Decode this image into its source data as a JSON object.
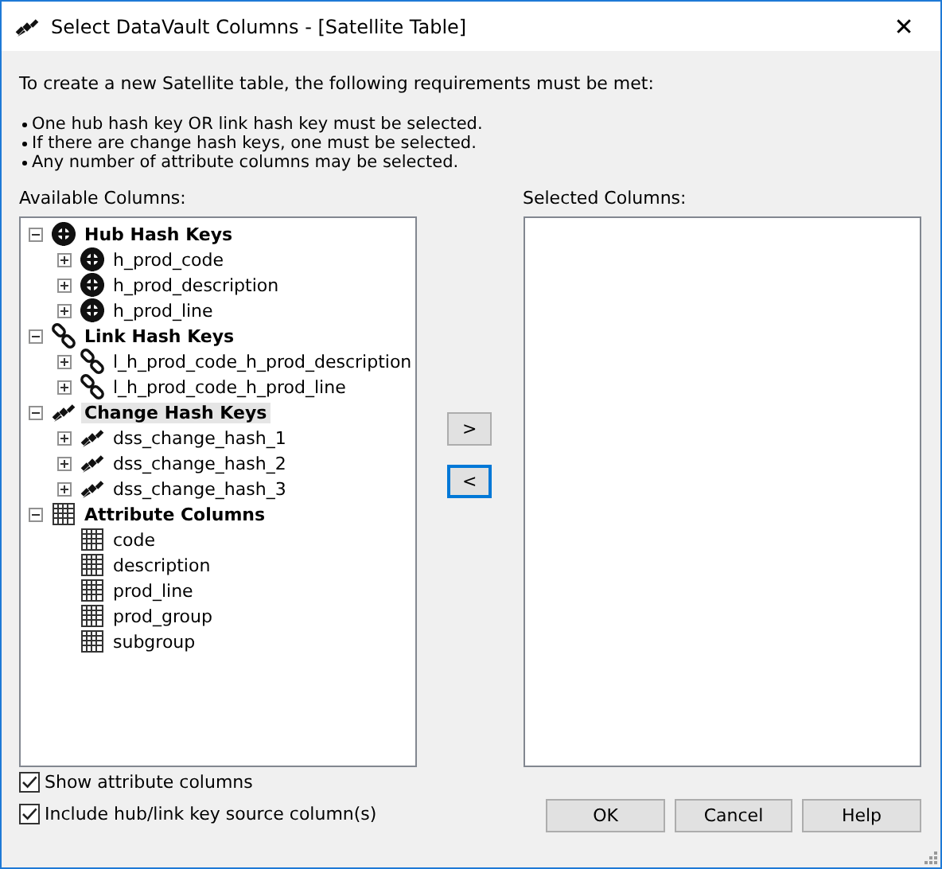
{
  "window": {
    "title": "Select DataVault Columns - [Satellite Table]",
    "close": "✕"
  },
  "intro": "To create a new Satellite table, the following requirements must be met:",
  "requirements": [
    "One hub hash key OR link hash key must be selected.",
    "If there are change hash keys, one must be selected.",
    "Any number of attribute columns may be selected."
  ],
  "available": {
    "label": "Available Columns:",
    "tree": [
      {
        "label": "Hub Hash Keys",
        "kind": "hub",
        "expanded": true,
        "selected": false,
        "children": [
          {
            "label": "h_prod_code",
            "expandable": true,
            "selected": false
          },
          {
            "label": "h_prod_description",
            "expandable": true,
            "selected": false
          },
          {
            "label": "h_prod_line",
            "expandable": true,
            "selected": false
          }
        ]
      },
      {
        "label": "Link Hash Keys",
        "kind": "link",
        "expanded": true,
        "selected": false,
        "children": [
          {
            "label": "l_h_prod_code_h_prod_description",
            "expandable": true,
            "selected": false
          },
          {
            "label": "l_h_prod_code_h_prod_line",
            "expandable": true,
            "selected": false
          }
        ]
      },
      {
        "label": "Change Hash Keys",
        "kind": "change",
        "expanded": true,
        "selected": true,
        "children": [
          {
            "label": "dss_change_hash_1",
            "expandable": true,
            "selected": false
          },
          {
            "label": "dss_change_hash_2",
            "expandable": true,
            "selected": false
          },
          {
            "label": "dss_change_hash_3",
            "expandable": true,
            "selected": false
          }
        ]
      },
      {
        "label": "Attribute Columns",
        "kind": "attribute",
        "expanded": true,
        "selected": false,
        "children": [
          {
            "label": "code",
            "expandable": false,
            "selected": false
          },
          {
            "label": "description",
            "expandable": false,
            "selected": false
          },
          {
            "label": "prod_line",
            "expandable": false,
            "selected": false
          },
          {
            "label": "prod_group",
            "expandable": false,
            "selected": false
          },
          {
            "label": "subgroup",
            "expandable": false,
            "selected": false
          }
        ]
      }
    ]
  },
  "move_buttons": [
    {
      "label": ">",
      "focused": false
    },
    {
      "label": "<",
      "focused": true
    }
  ],
  "selected_columns": {
    "label": "Selected Columns:"
  },
  "options": [
    {
      "label": "Show attribute columns",
      "checked": true
    },
    {
      "label": "Include hub/link key source column(s)",
      "checked": true
    }
  ],
  "buttons": [
    "OK",
    "Cancel",
    "Help"
  ]
}
